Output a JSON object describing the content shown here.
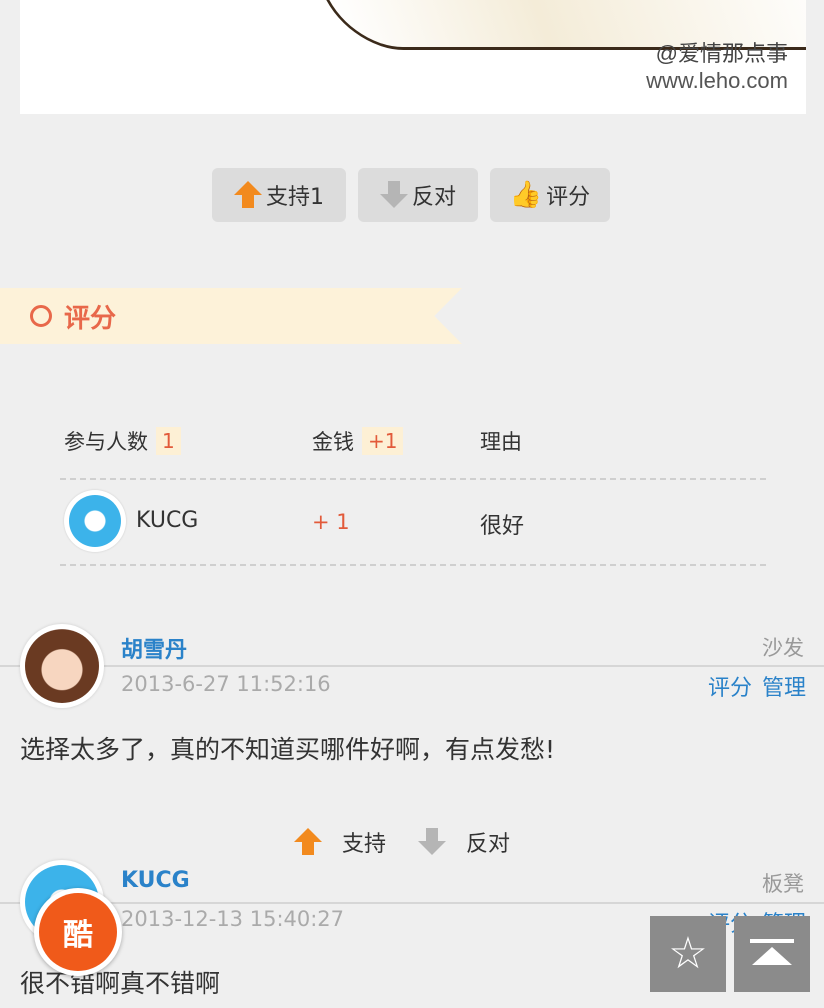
{
  "image_card": {
    "watermark_1": "@爱情那点事",
    "watermark_2": "www.leho.com"
  },
  "vote_bar": {
    "support_label": "支持1",
    "oppose_label": "反对",
    "rate_label": "评分"
  },
  "rating_section": {
    "title": "评分",
    "header": {
      "participants_label": "参与人数",
      "participants_count": "1",
      "money_label": "金钱",
      "money_total": "+1",
      "reason_label": "理由"
    },
    "rows": [
      {
        "user": "KUCG",
        "money": "+ 1",
        "reason": "很好"
      }
    ]
  },
  "comments": [
    {
      "author": "胡雪丹",
      "floor": "沙发",
      "time": "2013-6-27 11:52:16",
      "rate_action": "评分",
      "manage_action": "管理",
      "text": "选择太多了，真的不知道买哪件好啊，有点发愁!",
      "support_label": "支持",
      "oppose_label": "反对"
    },
    {
      "author": "KUCG",
      "floor": "板凳",
      "time": "2013-12-13 15:40:27",
      "rate_action": "评分",
      "manage_action": "管理",
      "text": "很不错啊真不错啊"
    }
  ],
  "floating": {
    "logo_text": "酷",
    "favorite_icon": "star-icon",
    "top_icon": "back-to-top-icon"
  },
  "colors": {
    "accent_orange": "#e8684a",
    "link_blue": "#2a82c9",
    "banner_bg": "#fdf2d9"
  }
}
